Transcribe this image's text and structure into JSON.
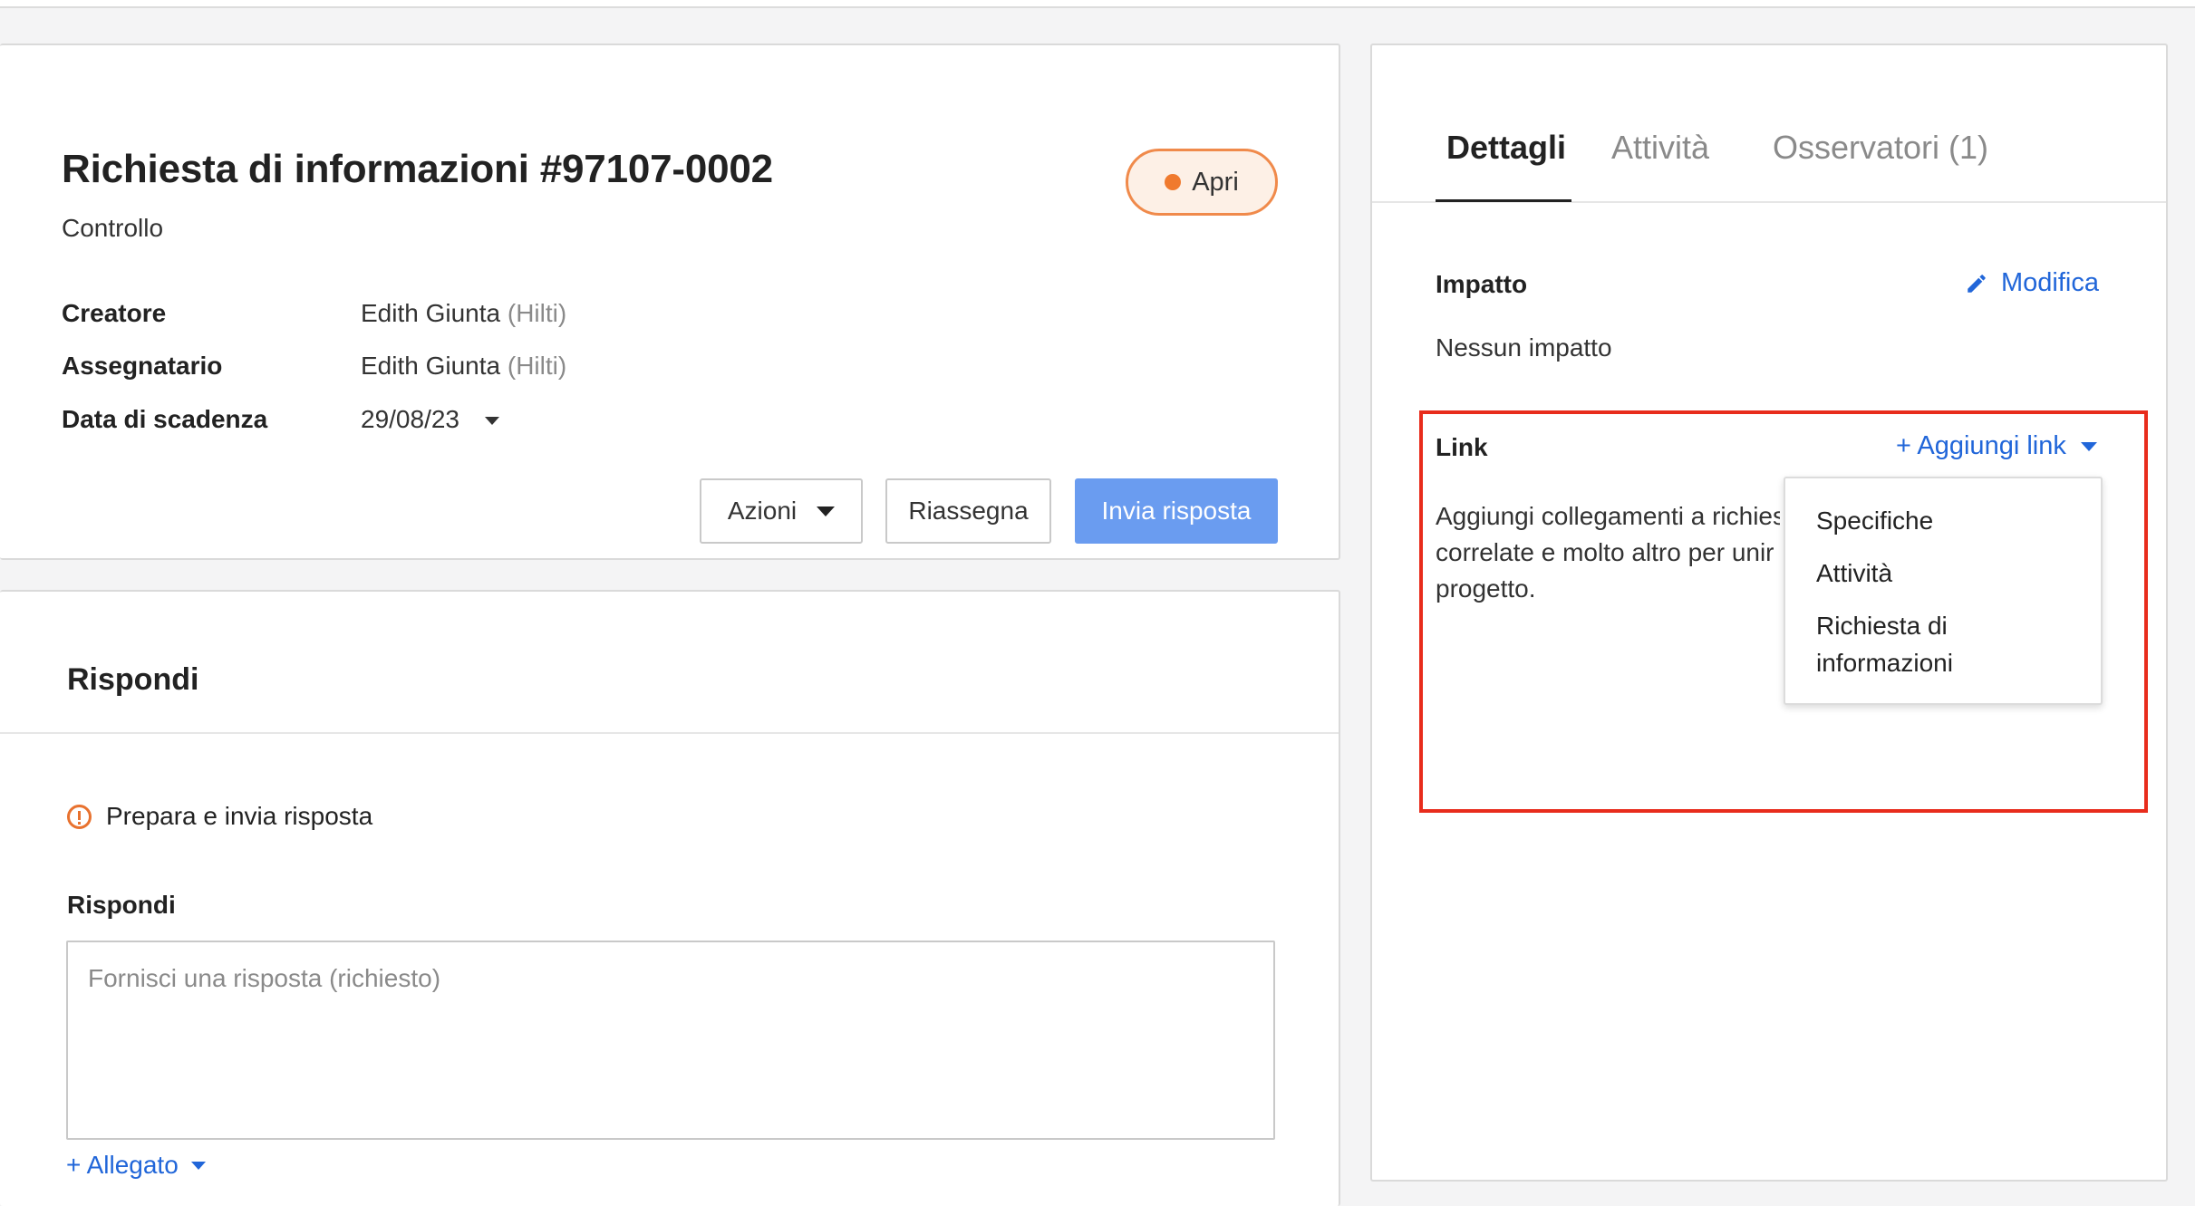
{
  "rfi": {
    "title": "Richiesta di informazioni #97107-0002",
    "subtitle": "Controllo",
    "status": "Apri",
    "status_color": "#f07a2e",
    "fields": [
      {
        "label": "Creatore",
        "name": "Edith Giunta",
        "org": "(Hilti)"
      },
      {
        "label": "Assegnatario",
        "name": "Edith Giunta",
        "org": "(Hilti)"
      },
      {
        "label": "Data di scadenza",
        "value": "29/08/23"
      }
    ],
    "actions": {
      "actions_label": "Azioni",
      "reassign_label": "Riassegna",
      "send_label": "Invia risposta"
    }
  },
  "reply": {
    "heading": "Rispondi",
    "notice": "Prepara e invia risposta",
    "field_label": "Rispondi",
    "placeholder": "Fornisci una risposta (richiesto)",
    "attach_label": "+ Allegato"
  },
  "details": {
    "tabs": [
      {
        "label": "Dettagli",
        "active": true
      },
      {
        "label": "Attività",
        "active": false
      },
      {
        "label": "Osservatori (1)",
        "active": false
      }
    ],
    "impact": {
      "label": "Impatto",
      "edit_label": "Modifica",
      "value": "Nessun impatto"
    },
    "links": {
      "label": "Link",
      "add_label": "+ Aggiungi link",
      "description_lines": [
        "Aggiungi collegamenti a richies",
        "correlate e molto altro per unir",
        "progetto."
      ],
      "menu": [
        "Specifiche",
        "Attività",
        "Richiesta di",
        "informazioni"
      ]
    }
  },
  "colors": {
    "accent": "#2166d9",
    "primary_button": "#6a9cf0",
    "warning": "#e8722f",
    "highlight": "#e82c1c"
  }
}
